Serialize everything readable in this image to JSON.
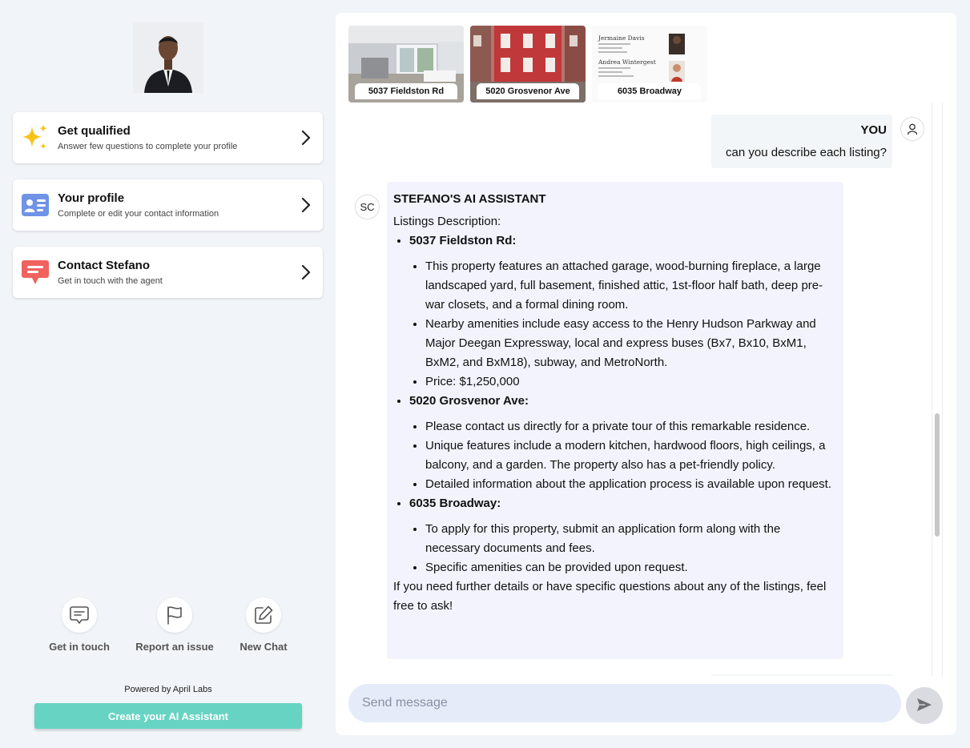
{
  "sidebar": {
    "cards": [
      {
        "title": "Get qualified",
        "subtitle": "Answer few questions to complete your profile",
        "icon": "sparkles-icon"
      },
      {
        "title": "Your profile",
        "subtitle": "Complete or edit your contact information",
        "icon": "contact-card-icon"
      },
      {
        "title": "Contact Stefano",
        "subtitle": "Get in touch with the agent",
        "icon": "chat-bubble-icon"
      }
    ],
    "quick_actions": [
      {
        "label": "Get in touch",
        "icon": "message-icon"
      },
      {
        "label": "Report an issue",
        "icon": "flag-icon"
      },
      {
        "label": "New Chat",
        "icon": "edit-icon"
      }
    ],
    "powered_by": "Powered by April Labs",
    "create_button": "Create your AI Assistant"
  },
  "listings": [
    {
      "label": "5037 Fieldston Rd"
    },
    {
      "label": "5020 Grosvenor Ave"
    },
    {
      "label": "6035 Broadway",
      "card_names": [
        "Jermaine Davis",
        "Andrea Wintergest"
      ]
    }
  ],
  "chat": {
    "user_message": {
      "sender": "YOU",
      "text": "can you describe each listing?"
    },
    "ai_message": {
      "avatar_initials": "SC",
      "sender": "STEFANO'S AI ASSISTANT",
      "intro": "Listings Description:",
      "items": [
        {
          "name": "5037 Fieldston Rd:",
          "points": [
            "This property features an attached garage, wood-burning fireplace, a large landscaped yard, full basement, finished attic, 1st-floor half bath, deep pre-war closets, and a formal dining room.",
            "Nearby amenities include easy access to the Henry Hudson Parkway and Major Deegan Expressway, local and express buses (Bx7, Bx10, BxM1, BxM2, and BxM18), subway, and MetroNorth.",
            "Price: $1,250,000"
          ]
        },
        {
          "name": "5020 Grosvenor Ave:",
          "points": [
            "Please contact us directly for a private tour of this remarkable residence.",
            "Unique features include a modern kitchen, hardwood floors, high ceilings, a balcony, and a garden. The property also has a pet-friendly policy.",
            "Detailed information about the application process is available upon request."
          ]
        },
        {
          "name": "6035 Broadway:",
          "points": [
            "To apply for this property, submit an application form along with the necessary documents and fees.",
            "Specific amenities can be provided upon request."
          ]
        }
      ],
      "outro": "If you need further details or have specific questions about any of the listings, feel free to ask!"
    },
    "input": {
      "placeholder": "Send message",
      "value": ""
    },
    "send_icon": "send-icon"
  },
  "colors": {
    "page_bg": "#f1f4f8",
    "accent": "#67d4c3",
    "ai_bubble": "#f2f3fc",
    "user_bubble": "#f2f6f8",
    "input_bg": "#e6ebf9"
  }
}
